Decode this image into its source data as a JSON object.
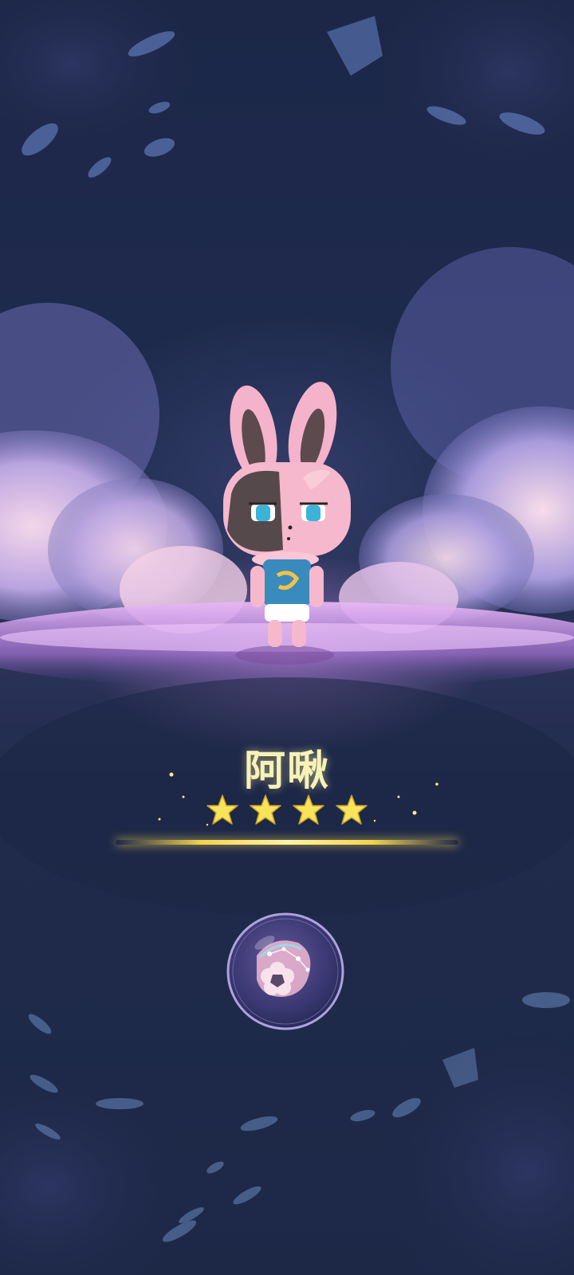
{
  "character": {
    "name": "阿啾",
    "rarity_stars": 4,
    "stars_max": 4
  },
  "colors": {
    "title": "#f6f2b8",
    "star_fill": "#f7e45a",
    "gold_line": "#f3d34f",
    "glow_platform": "#d796f0",
    "background": "#1e2a4a"
  },
  "icons": {
    "constellation_bubble": "constellation-bubble-icon",
    "character": "pink-bunny-character"
  }
}
